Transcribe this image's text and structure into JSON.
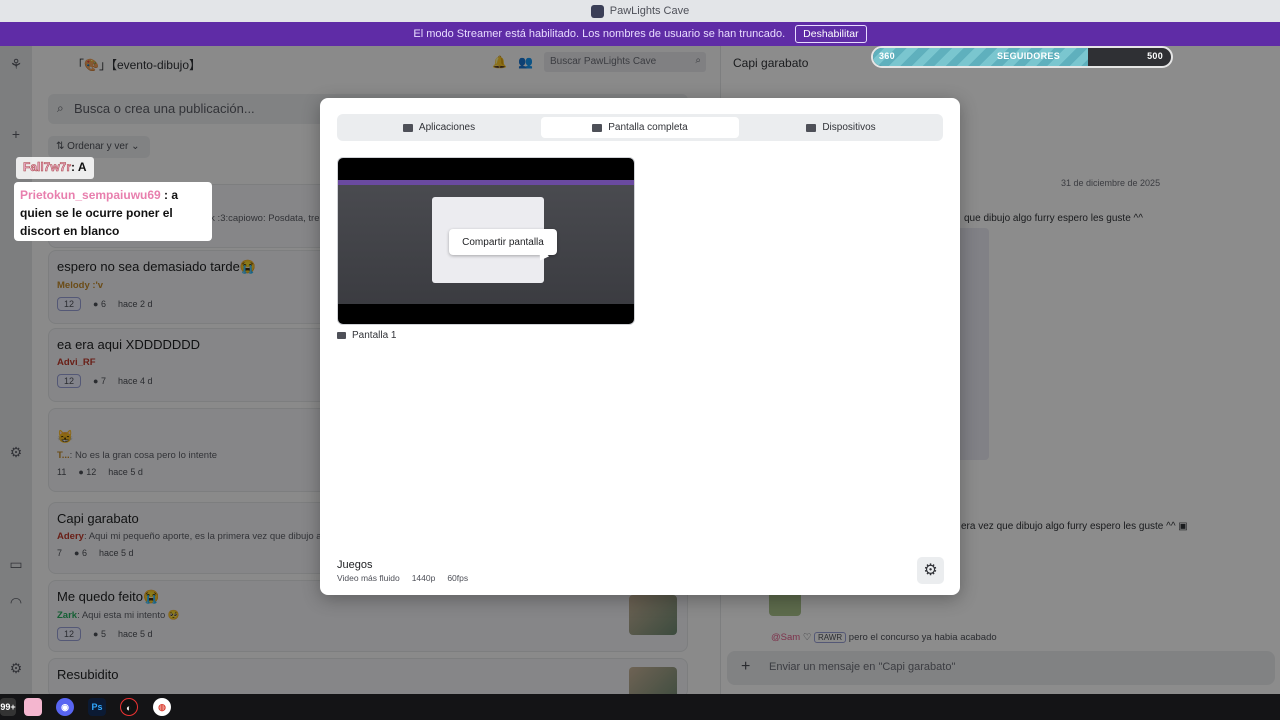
{
  "titlebar": {
    "title": "PawLights Cave"
  },
  "banner": {
    "text": "El modo Streamer está habilitado. Los nombres de usuario se han truncado.",
    "button": "Deshabilitar"
  },
  "followers": {
    "current": "360",
    "label": "SEGUIDORES",
    "goal": "500",
    "fraction": 0.72
  },
  "forum": {
    "channel": "「🎨」【evento-dibujo】",
    "search_placeholder": "Buscar PawLights Cave",
    "post_search_placeholder": "Busca o crea una publicación...",
    "sort_label": "Ordenar y ver",
    "posts": [
      {
        "title": "espero no sea demasiado tarde😭",
        "author": "Melody :'v",
        "snippet": "",
        "tag": "12",
        "comments": "6",
        "time": "hace 2 d"
      },
      {
        "title": "ea era aqui XDDDDDDD",
        "author": "Advi_RF",
        "snippet": "",
        "tag": "12",
        "comments": "7",
        "time": "hace 4 d"
      },
      {
        "title": "😸",
        "author": "T...",
        "snippet": ": No es la gran cosa pero lo intente",
        "tag": "11",
        "comments": "12",
        "time": "hace 5 d"
      },
      {
        "title": "Capi garabato",
        "author": "Adery",
        "snippet": ": Aqui mi pequeño aporte, es la primera vez que dibujo algo f",
        "tag": "7",
        "comments": "6",
        "time": "hace 5 d"
      },
      {
        "title": "Me quedo feito😭",
        "author": "Zark",
        "snippet": ": Aqui esta mi intento 🥺",
        "tag": "12",
        "comments": "5",
        "time": "hace 5 d"
      },
      {
        "title": "Resubidito",
        "author": "",
        "snippet": "",
        "tag": "",
        "comments": "",
        "time": ""
      }
    ],
    "partial_snippet": "rk :3:capiowo: Posdata, tre"
  },
  "chat": {
    "title": "Capi garabato",
    "date": "31 de diciembre de 2025",
    "msg1": "que dibujo algo furry espero les guste ^^",
    "msg2": "era vez que dibujo algo furry espero les guste ^^",
    "reply_user": "@Sam",
    "reply_tag": "RAWR",
    "reply_text": "pero el concurso ya habia acabado",
    "compose_placeholder": "Enviar un mensaje en \"Capi garabato\""
  },
  "notices": {
    "a_name": "Fall7w7r",
    "a_text": ": A",
    "b_name": "Prietokun_sempaiuwu69",
    "b_text": " : a quien se le ocurre poner el discort en blanco"
  },
  "modal": {
    "tabs": [
      {
        "label": "Aplicaciones",
        "active": false
      },
      {
        "label": "Pantalla completa",
        "active": true
      },
      {
        "label": "Dispositivos",
        "active": false
      }
    ],
    "share_button": "Compartir pantalla",
    "screen_label": "Pantalla 1",
    "games_title": "Juegos",
    "quality": [
      "Video más fluido",
      "1440p",
      "60fps"
    ]
  },
  "taskbar": {
    "badge": "99+",
    "ps_label": "Ps"
  }
}
